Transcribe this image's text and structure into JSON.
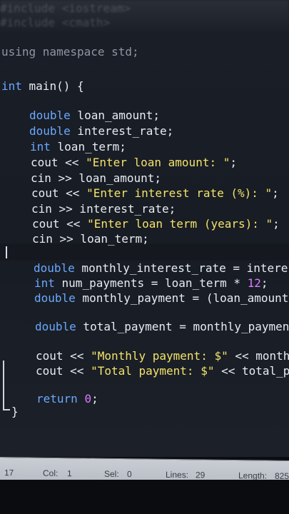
{
  "editor": {
    "blurred_top": [
      "#include <iostream>",
      "#include <cmath>"
    ],
    "lines": [
      {
        "tokens": [
          [
            "dim",
            "using namespace std;"
          ]
        ]
      },
      {
        "tokens": [
          [
            "kw",
            "int"
          ],
          [
            "id",
            " main() {"
          ]
        ]
      },
      {
        "tokens": [
          [
            "type",
            "double"
          ],
          [
            "id",
            " loan_amount;"
          ]
        ]
      },
      {
        "tokens": [
          [
            "type",
            "double"
          ],
          [
            "id",
            " interest_rate;"
          ]
        ]
      },
      {
        "tokens": [
          [
            "type",
            "int"
          ],
          [
            "id",
            " loan_term;"
          ]
        ]
      },
      {
        "tokens": [
          [
            "id",
            "cout << "
          ],
          [
            "str",
            "\"Enter loan amount: \""
          ],
          [
            "id",
            ";"
          ]
        ]
      },
      {
        "tokens": [
          [
            "id",
            "cin >> loan_amount;"
          ]
        ]
      },
      {
        "tokens": [
          [
            "id",
            "cout << "
          ],
          [
            "str",
            "\"Enter interest rate (%): \""
          ],
          [
            "id",
            ";"
          ]
        ]
      },
      {
        "tokens": [
          [
            "id",
            "cin >> interest_rate;"
          ]
        ]
      },
      {
        "tokens": [
          [
            "id",
            "cout << "
          ],
          [
            "str",
            "\"Enter loan term (years): \""
          ],
          [
            "id",
            ";"
          ]
        ]
      },
      {
        "tokens": [
          [
            "id",
            "cin >> loan_term;"
          ]
        ]
      },
      {
        "tokens": [
          [
            "type",
            "double"
          ],
          [
            "id",
            " monthly_interest_rate = interes"
          ]
        ]
      },
      {
        "tokens": [
          [
            "type",
            "int"
          ],
          [
            "id",
            " num_payments = loan_term * "
          ],
          [
            "num",
            "12"
          ],
          [
            "id",
            ";"
          ]
        ]
      },
      {
        "tokens": [
          [
            "type",
            "double"
          ],
          [
            "id",
            " monthly_payment = (loan_amount"
          ]
        ]
      },
      {
        "tokens": [
          [
            "type",
            "double"
          ],
          [
            "id",
            " total_payment = monthly_payment"
          ]
        ]
      },
      {
        "tokens": [
          [
            "id",
            "cout << "
          ],
          [
            "str",
            "\"Monthly payment: $\""
          ],
          [
            "id",
            " << monthl"
          ]
        ]
      },
      {
        "tokens": [
          [
            "id",
            "cout << "
          ],
          [
            "str",
            "\"Total payment: $\""
          ],
          [
            "id",
            " << total_pa"
          ]
        ]
      },
      {
        "tokens": [
          [
            "kw",
            "return"
          ],
          [
            "id",
            " "
          ],
          [
            "num",
            "0"
          ],
          [
            "id",
            ";"
          ]
        ]
      },
      {
        "tokens": [
          [
            "id",
            "}"
          ]
        ]
      }
    ]
  },
  "status": {
    "line_num": "17",
    "col_label": "Col:",
    "col_value": "1",
    "sel_label": "Sel:",
    "sel_value": "0",
    "lines_label": "Lines:",
    "lines_value": "29",
    "length_label": "Length:",
    "length_value": "825"
  }
}
